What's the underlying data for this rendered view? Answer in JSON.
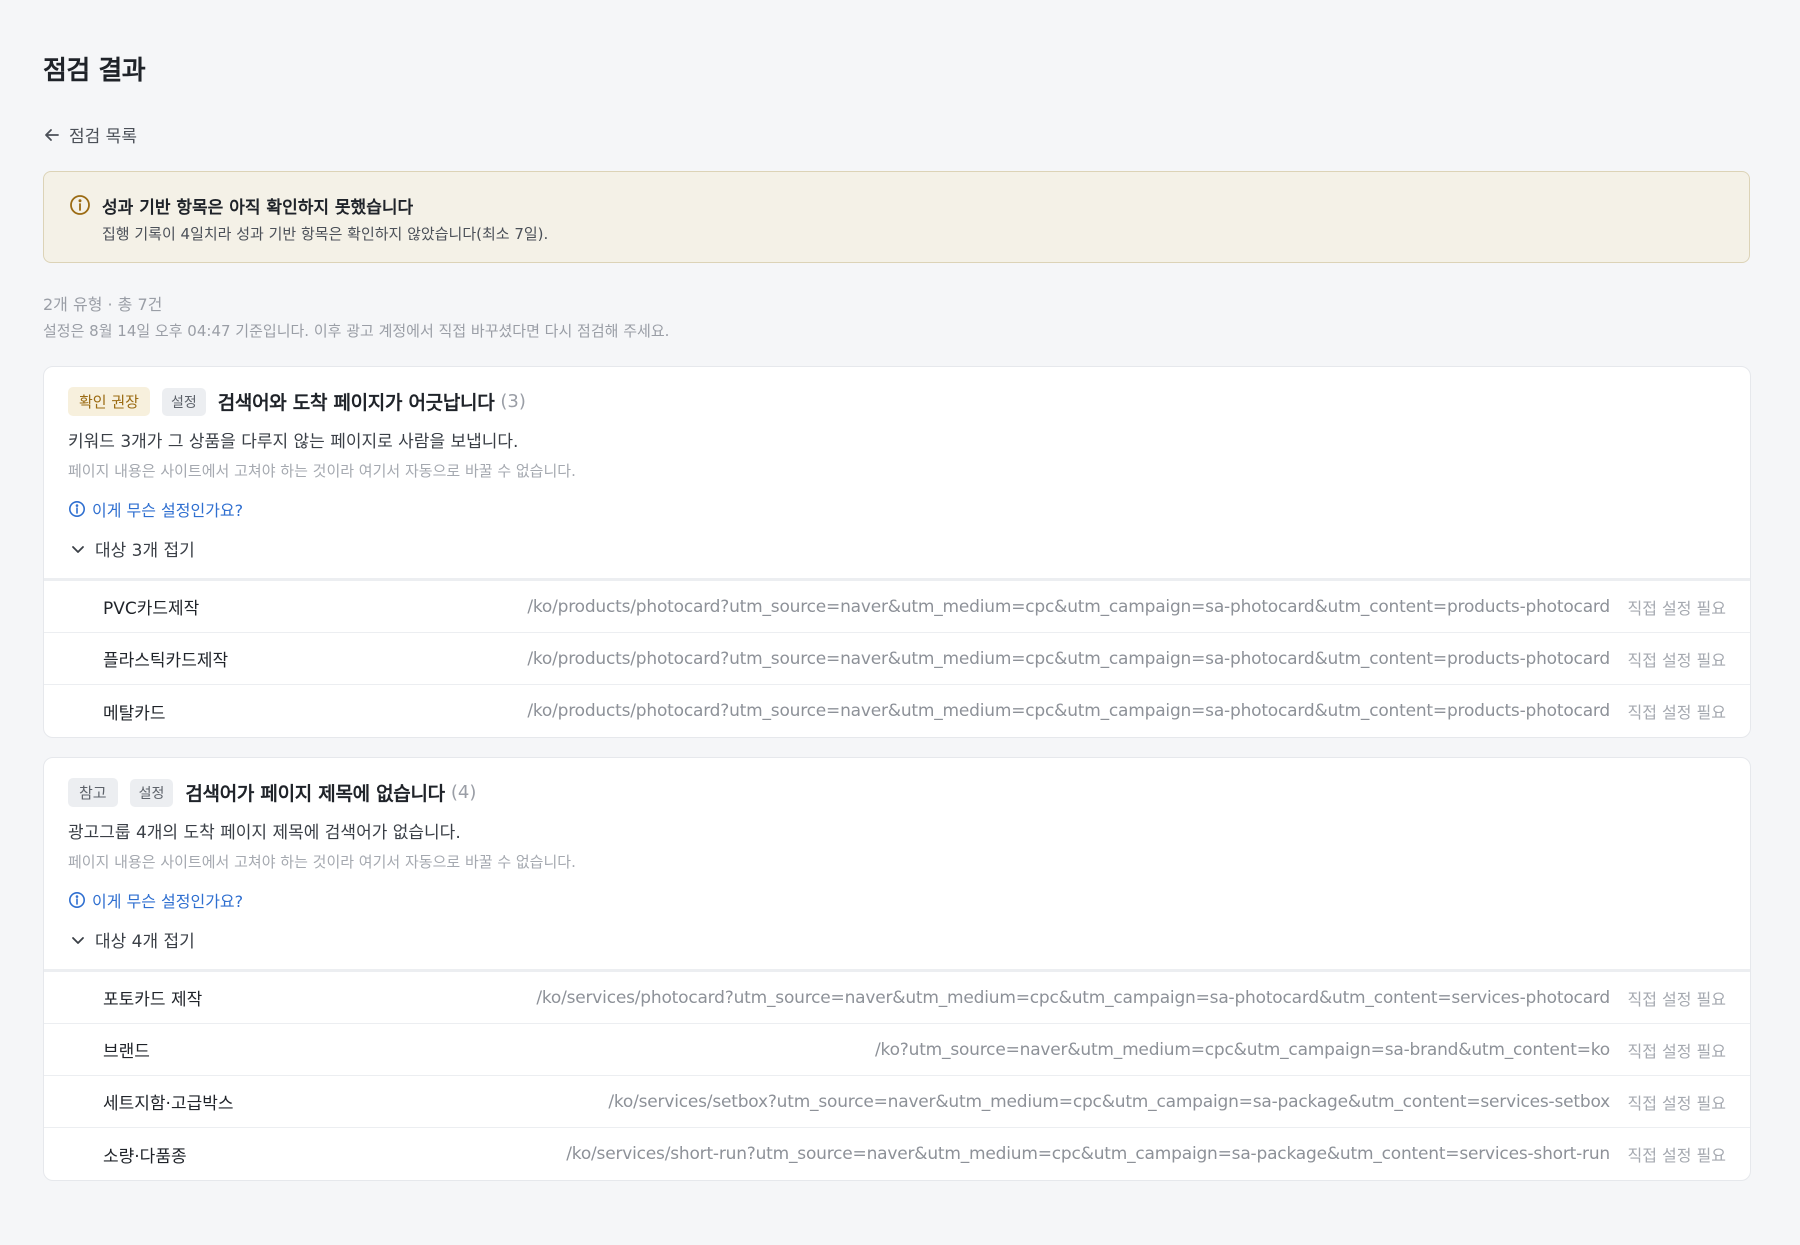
{
  "page": {
    "title": "점검 결과",
    "back_label": "점검 목록"
  },
  "notice": {
    "title": "성과 기반 항목은 아직 확인하지 못했습니다",
    "body": "집행 기록이 4일치라 성과 기반 항목은 확인하지 않았습니다(최소 7일)."
  },
  "summary": {
    "counts": "2개 유형 · 총 7건",
    "basis": "설정은 8월 14일 오후 04:47 기준입니다. 이후 광고 계정에서 직접 바꾸셨다면 다시 점검해 주세요."
  },
  "colors": {
    "accent_link": "#2f6fd0",
    "warn_tag_bg": "#f7f0dd",
    "warn_tag_text": "#9b6b13",
    "notice_bg": "#f4f1e7"
  },
  "cards": [
    {
      "severity": "확인 권장",
      "category": "설정",
      "title": "검색어와 도착 페이지가 어긋납니다",
      "count": "(3)",
      "description": "키워드 3개가 그 상품을 다루지 않는 페이지로 사람을 보냅니다.",
      "note": "페이지 내용은 사이트에서 고쳐야 하는 것이라 여기서 자동으로 바꿀 수 없습니다.",
      "help_label": "이게 무슨 설정인가요?",
      "toggle_label": "대상 3개 접기",
      "rows": [
        {
          "keyword": "PVC카드제작",
          "url": "/ko/products/photocard?utm_source=naver&utm_medium=cpc&utm_campaign=sa-photocard&utm_content=products-photocard",
          "status": "직접 설정 필요"
        },
        {
          "keyword": "플라스틱카드제작",
          "url": "/ko/products/photocard?utm_source=naver&utm_medium=cpc&utm_campaign=sa-photocard&utm_content=products-photocard",
          "status": "직접 설정 필요"
        },
        {
          "keyword": "메탈카드",
          "url": "/ko/products/photocard?utm_source=naver&utm_medium=cpc&utm_campaign=sa-photocard&utm_content=products-photocard",
          "status": "직접 설정 필요"
        }
      ]
    },
    {
      "severity": "참고",
      "category": "설정",
      "title": "검색어가 페이지 제목에 없습니다",
      "count": "(4)",
      "description": "광고그룹 4개의 도착 페이지 제목에 검색어가 없습니다.",
      "note": "페이지 내용은 사이트에서 고쳐야 하는 것이라 여기서 자동으로 바꿀 수 없습니다.",
      "help_label": "이게 무슨 설정인가요?",
      "toggle_label": "대상 4개 접기",
      "rows": [
        {
          "keyword": "포토카드 제작",
          "url": "/ko/services/photocard?utm_source=naver&utm_medium=cpc&utm_campaign=sa-photocard&utm_content=services-photocard",
          "status": "직접 설정 필요"
        },
        {
          "keyword": "브랜드",
          "url": "/ko?utm_source=naver&utm_medium=cpc&utm_campaign=sa-brand&utm_content=ko",
          "status": "직접 설정 필요"
        },
        {
          "keyword": "세트지함·고급박스",
          "url": "/ko/services/setbox?utm_source=naver&utm_medium=cpc&utm_campaign=sa-package&utm_content=services-setbox",
          "status": "직접 설정 필요"
        },
        {
          "keyword": "소량·다품종",
          "url": "/ko/services/short-run?utm_source=naver&utm_medium=cpc&utm_campaign=sa-package&utm_content=services-short-run",
          "status": "직접 설정 필요"
        }
      ]
    }
  ]
}
